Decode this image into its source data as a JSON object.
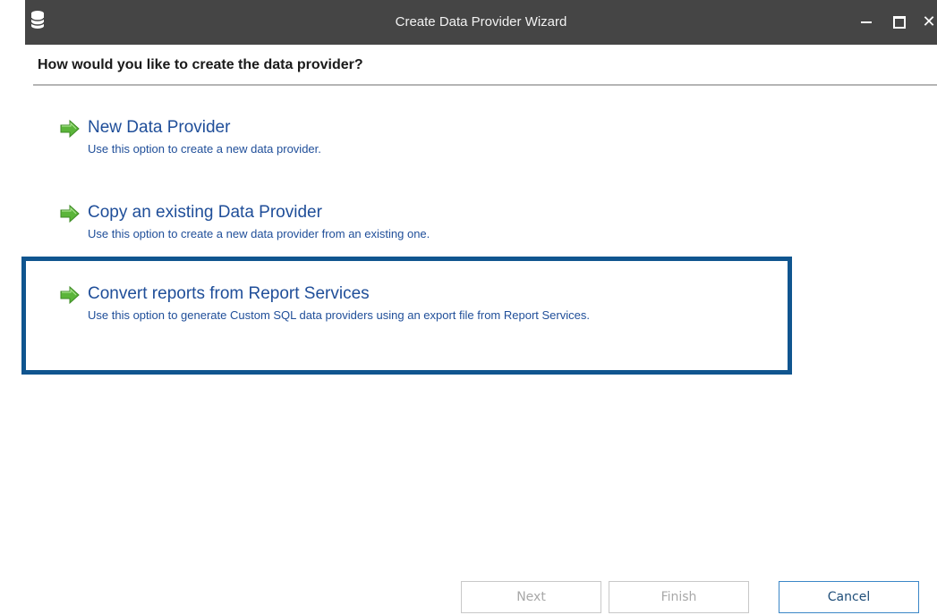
{
  "window": {
    "title": "Create Data Provider Wizard",
    "controls": {
      "minimize": "minimize",
      "maximize": "maximize",
      "close": "✕"
    }
  },
  "page": {
    "question": "How would you like to create the data provider?"
  },
  "options": [
    {
      "icon": "green-arrow-icon",
      "title": "New Data Provider",
      "description": "Use this option to create a new data provider."
    },
    {
      "icon": "green-arrow-icon",
      "title": "Copy an existing Data Provider",
      "description": "Use this option to create a new data provider from an existing one."
    },
    {
      "icon": "green-arrow-icon",
      "title": "Convert reports from Report Services",
      "description": "Use this option to generate Custom SQL data providers using an export file from Report Services.",
      "highlighted": true
    }
  ],
  "buttons": {
    "next": "Next",
    "finish": "Finish",
    "cancel": "Cancel"
  },
  "colors": {
    "titlebar": "#454545",
    "option_text": "#1f4e99",
    "highlight_border": "#10558f",
    "arrow_green": "#5bb53a"
  }
}
